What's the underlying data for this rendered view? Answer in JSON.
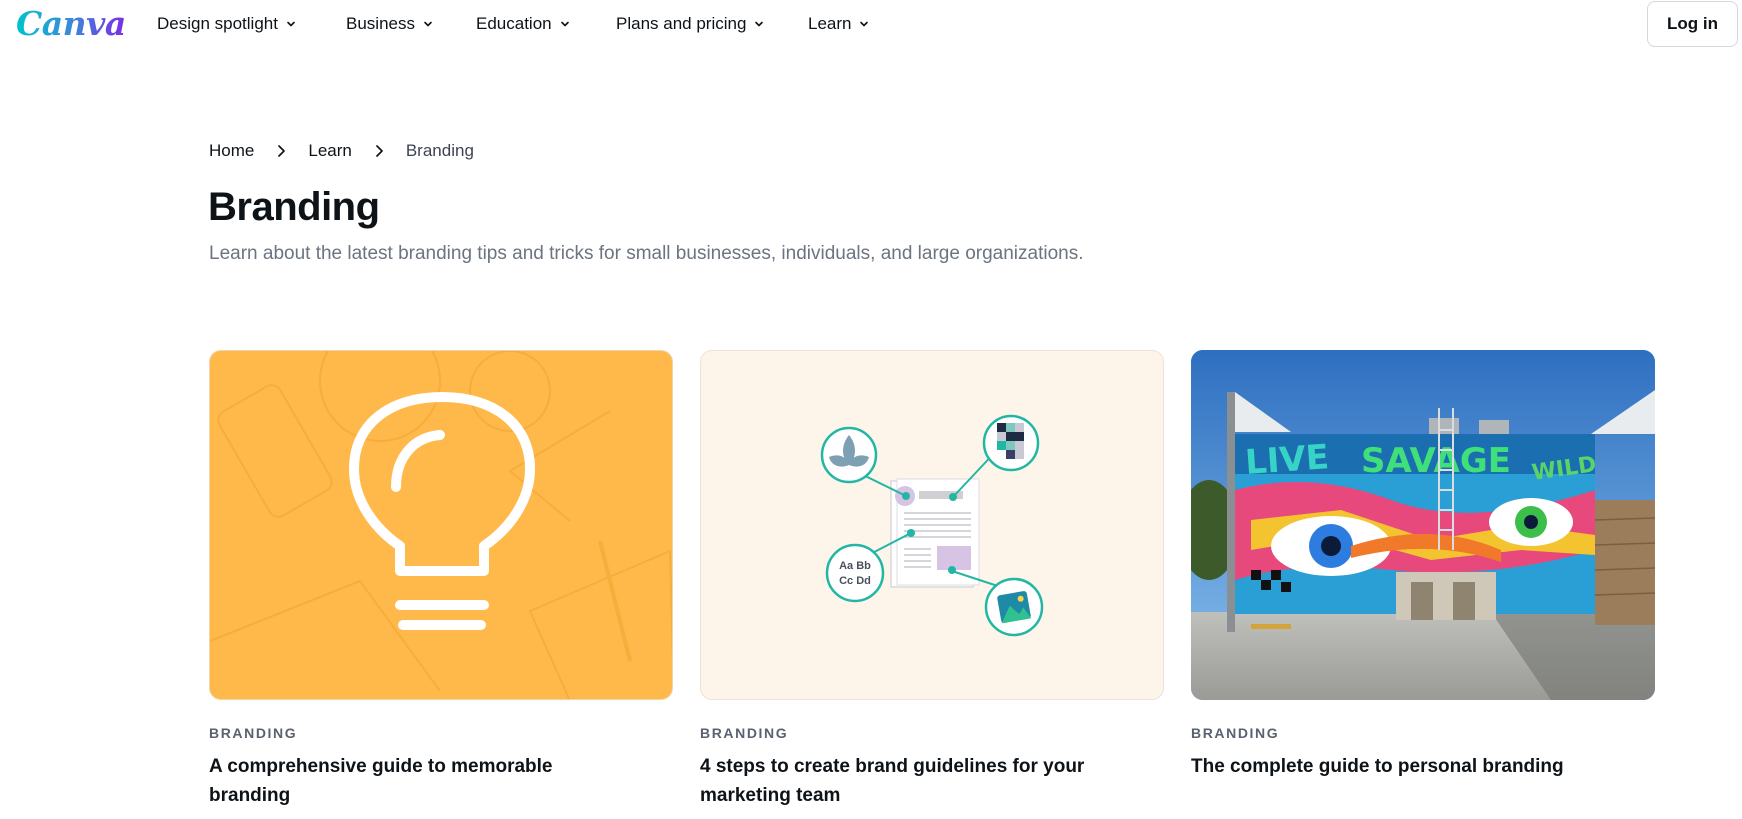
{
  "nav": {
    "logo_text": "Canva",
    "items": [
      {
        "label": "Design spotlight"
      },
      {
        "label": "Business"
      },
      {
        "label": "Education"
      },
      {
        "label": "Plans and pricing"
      },
      {
        "label": "Learn"
      }
    ],
    "login_label": "Log in"
  },
  "breadcrumb": {
    "items": [
      "Home",
      "Learn"
    ],
    "current": "Branding"
  },
  "page": {
    "title": "Branding",
    "subtitle": "Learn about the latest branding tips and tricks for small businesses, individuals, and large organizations."
  },
  "cards": [
    {
      "tag": "BRANDING",
      "title": "A comprehensive guide to memorable branding",
      "image": "lightbulb-illustration",
      "image_color": "#ffb94a"
    },
    {
      "tag": "BRANDING",
      "title": "4 steps to create brand guidelines for your marketing team",
      "image": "brand-guidelines-illustration",
      "image_color": "#fdf5ea",
      "font_sample": "Aa Bb Cc Dd"
    },
    {
      "tag": "BRANDING",
      "title": "The complete guide to personal branding",
      "image": "mural-photo",
      "image_color": "#4a8fd4",
      "mural_text": "LIVE SAVAGE WILD"
    }
  ],
  "colors": {
    "text": "#0e1318",
    "muted": "#6b7480",
    "teal": "#23b6a4",
    "brand_gradient": [
      "#00c4cc",
      "#7d2ae8"
    ]
  }
}
